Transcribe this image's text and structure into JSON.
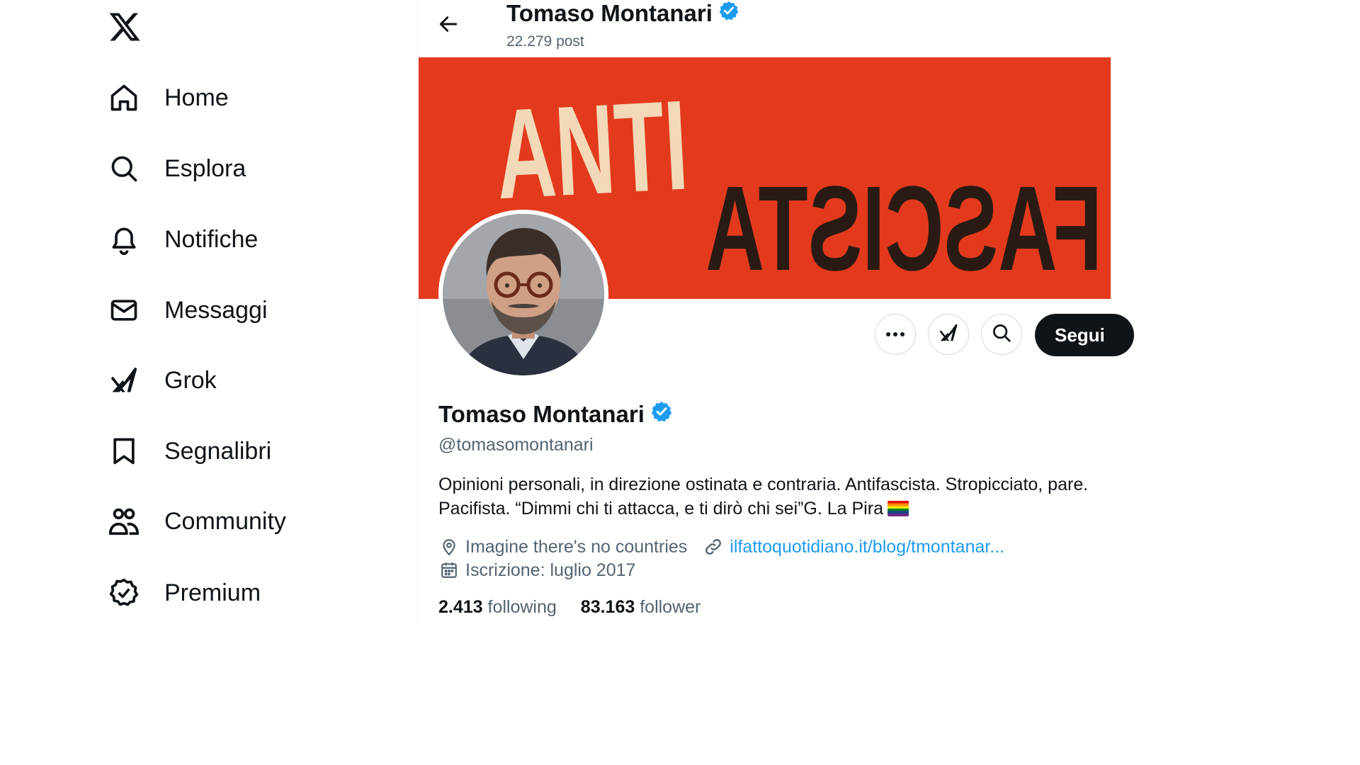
{
  "nav": {
    "items": [
      {
        "label": "Home",
        "icon": "home-icon"
      },
      {
        "label": "Esplora",
        "icon": "search-icon"
      },
      {
        "label": "Notifiche",
        "icon": "bell-icon"
      },
      {
        "label": "Messaggi",
        "icon": "mail-icon"
      },
      {
        "label": "Grok",
        "icon": "grok-icon"
      },
      {
        "label": "Segnalibri",
        "icon": "bookmark-icon"
      },
      {
        "label": "Community",
        "icon": "community-icon"
      },
      {
        "label": "Premium",
        "icon": "premium-icon"
      }
    ]
  },
  "header": {
    "name": "Tomaso Montanari",
    "posts": "22.279 post"
  },
  "banner": {
    "line1": "ANTI",
    "line2": "FASCISTA"
  },
  "actions": {
    "follow_label": "Segui"
  },
  "profile": {
    "name": "Tomaso Montanari",
    "handle": "@tomasomontanari",
    "bio": "Opinioni personali, in direzione ostinata e contraria. Antifascista. Stropicciato, pare. Pacifista. “Dimmi chi ti attacca, e ti dirò chi sei”G. La Pira",
    "location": "Imagine there's no countries",
    "website": "ilfattoquotidiano.it/blog/tmontanar...",
    "joined": "Iscrizione: luglio 2017",
    "following_count": "2.413",
    "following_label": "following",
    "followers_count": "83.163",
    "followers_label": "follower"
  },
  "colors": {
    "accent": "#1d9bf0",
    "banner_red": "#e33a1d",
    "text_primary": "#0f1419",
    "text_secondary": "#536471"
  }
}
